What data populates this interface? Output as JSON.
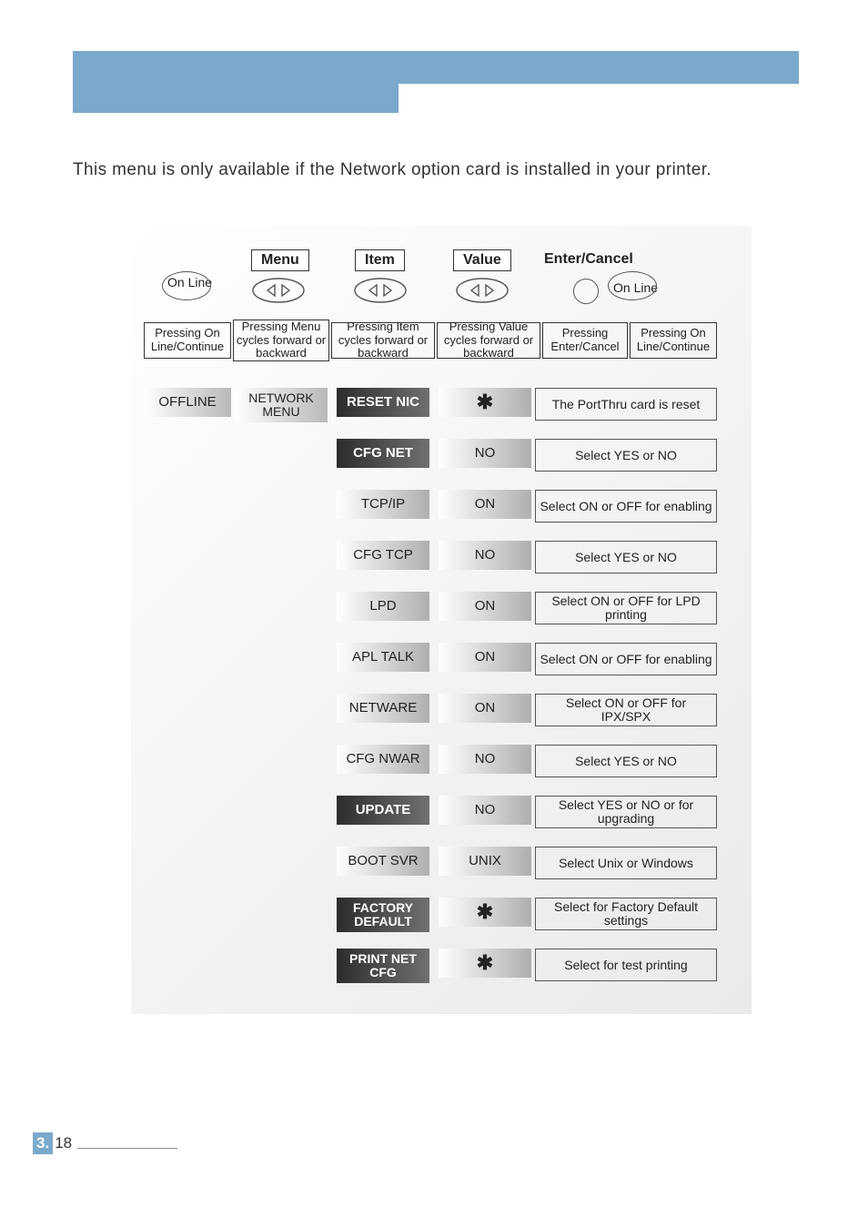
{
  "intro_text": "This menu is only available if the Network option card is installed in your printer.",
  "on_line": "On Line",
  "headers": {
    "menu": "Menu",
    "item": "Item",
    "value": "Value",
    "enter": "Enter/Cancel"
  },
  "desc": {
    "online": "Pressing On Line/Continue",
    "menu": "Pressing Menu cycles forward or backward",
    "item": "Pressing Item cycles forward or backward",
    "value": "Pressing Value cycles forward or backward",
    "enter": "Pressing Enter/Cancel",
    "online2": "Pressing On Line/Continue"
  },
  "offline": "OFFLINE",
  "menu_box": "NETWORK MENU",
  "rows": [
    {
      "item": "RESET NIC",
      "item_dark": true,
      "value": "*",
      "value_star": true,
      "enter": "The PortThru card is reset"
    },
    {
      "item": "CFG NET",
      "item_dark": true,
      "value": "NO",
      "value_star": false,
      "enter": "Select YES or NO"
    },
    {
      "item": "TCP/IP",
      "item_dark": false,
      "value": "ON",
      "value_star": false,
      "enter": "Select ON or OFF for enabling"
    },
    {
      "item": "CFG TCP",
      "item_dark": false,
      "value": "NO",
      "value_star": false,
      "enter": "Select YES or NO"
    },
    {
      "item": "LPD",
      "item_dark": false,
      "value": "ON",
      "value_star": false,
      "enter": "Select ON or OFF for LPD printing"
    },
    {
      "item": "APL TALK",
      "item_dark": false,
      "value": "ON",
      "value_star": false,
      "enter": "Select ON or OFF for enabling"
    },
    {
      "item": "NETWARE",
      "item_dark": false,
      "value": "ON",
      "value_star": false,
      "enter": "Select ON or OFF for IPX/SPX"
    },
    {
      "item": "CFG NWAR",
      "item_dark": false,
      "value": "NO",
      "value_star": false,
      "enter": "Select YES or NO"
    },
    {
      "item": "UPDATE",
      "item_dark": true,
      "value": "NO",
      "value_star": false,
      "enter": "Select YES or NO or for upgrading"
    },
    {
      "item": "BOOT SVR",
      "item_dark": false,
      "value": "UNIX",
      "value_star": false,
      "enter": "Select Unix or Windows"
    },
    {
      "item": "FACTORY DEFAULT",
      "item_dark": true,
      "value": "*",
      "value_star": true,
      "enter": "Select for Factory Default settings"
    },
    {
      "item": "PRINT NET CFG",
      "item_dark": true,
      "value": "*",
      "value_star": true,
      "enter": "Select for test printing"
    }
  ],
  "footer": {
    "section": "3.",
    "page": "18"
  }
}
